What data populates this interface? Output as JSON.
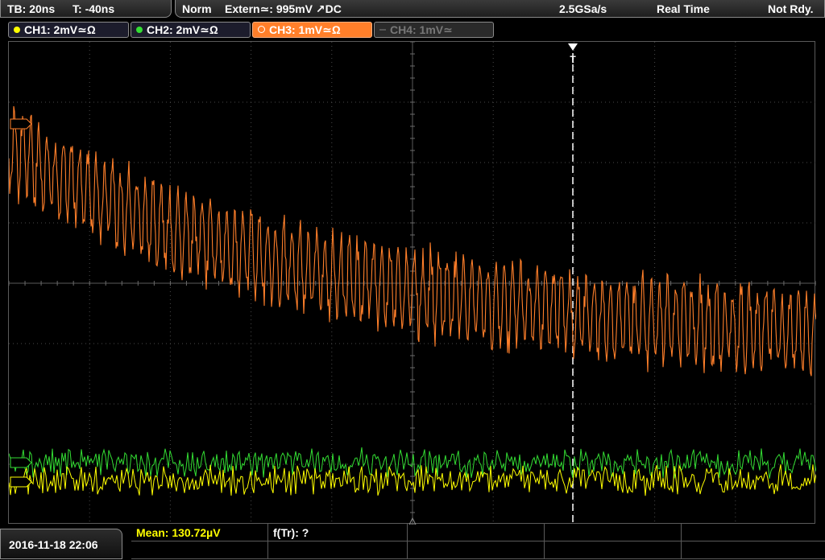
{
  "topbar": {
    "timebase": "TB: 20ns",
    "trigger_offset": "T: -40ns",
    "mode": "Norm",
    "trigger_source": "Extern≃: 995mV ↗DC",
    "sample_rate": "2.5GSa/s",
    "acq_mode": "Real Time",
    "status": "Not Rdy."
  },
  "channels": [
    {
      "label": "CH1: 2mV≃Ω",
      "color": "#ffff00",
      "active": true
    },
    {
      "label": "CH2: 2mV≃Ω",
      "color": "#33dd33",
      "active": true
    },
    {
      "label": "CH3: 1mV≃Ω",
      "color": "#ff7f2a",
      "active": true
    },
    {
      "label": "CH4: 1mV≃",
      "color": "#666666",
      "active": false
    }
  ],
  "trigger_marker": "T",
  "bottom": {
    "datetime": "2016-11-18 22:06",
    "measurement": "Mean: 130.72µV",
    "freq": "f(Tr): ?"
  },
  "colors": {
    "ch1": "#ffff00",
    "ch2": "#33dd33",
    "ch3": "#ff7f2a",
    "grid": "#4a4a4a"
  }
}
